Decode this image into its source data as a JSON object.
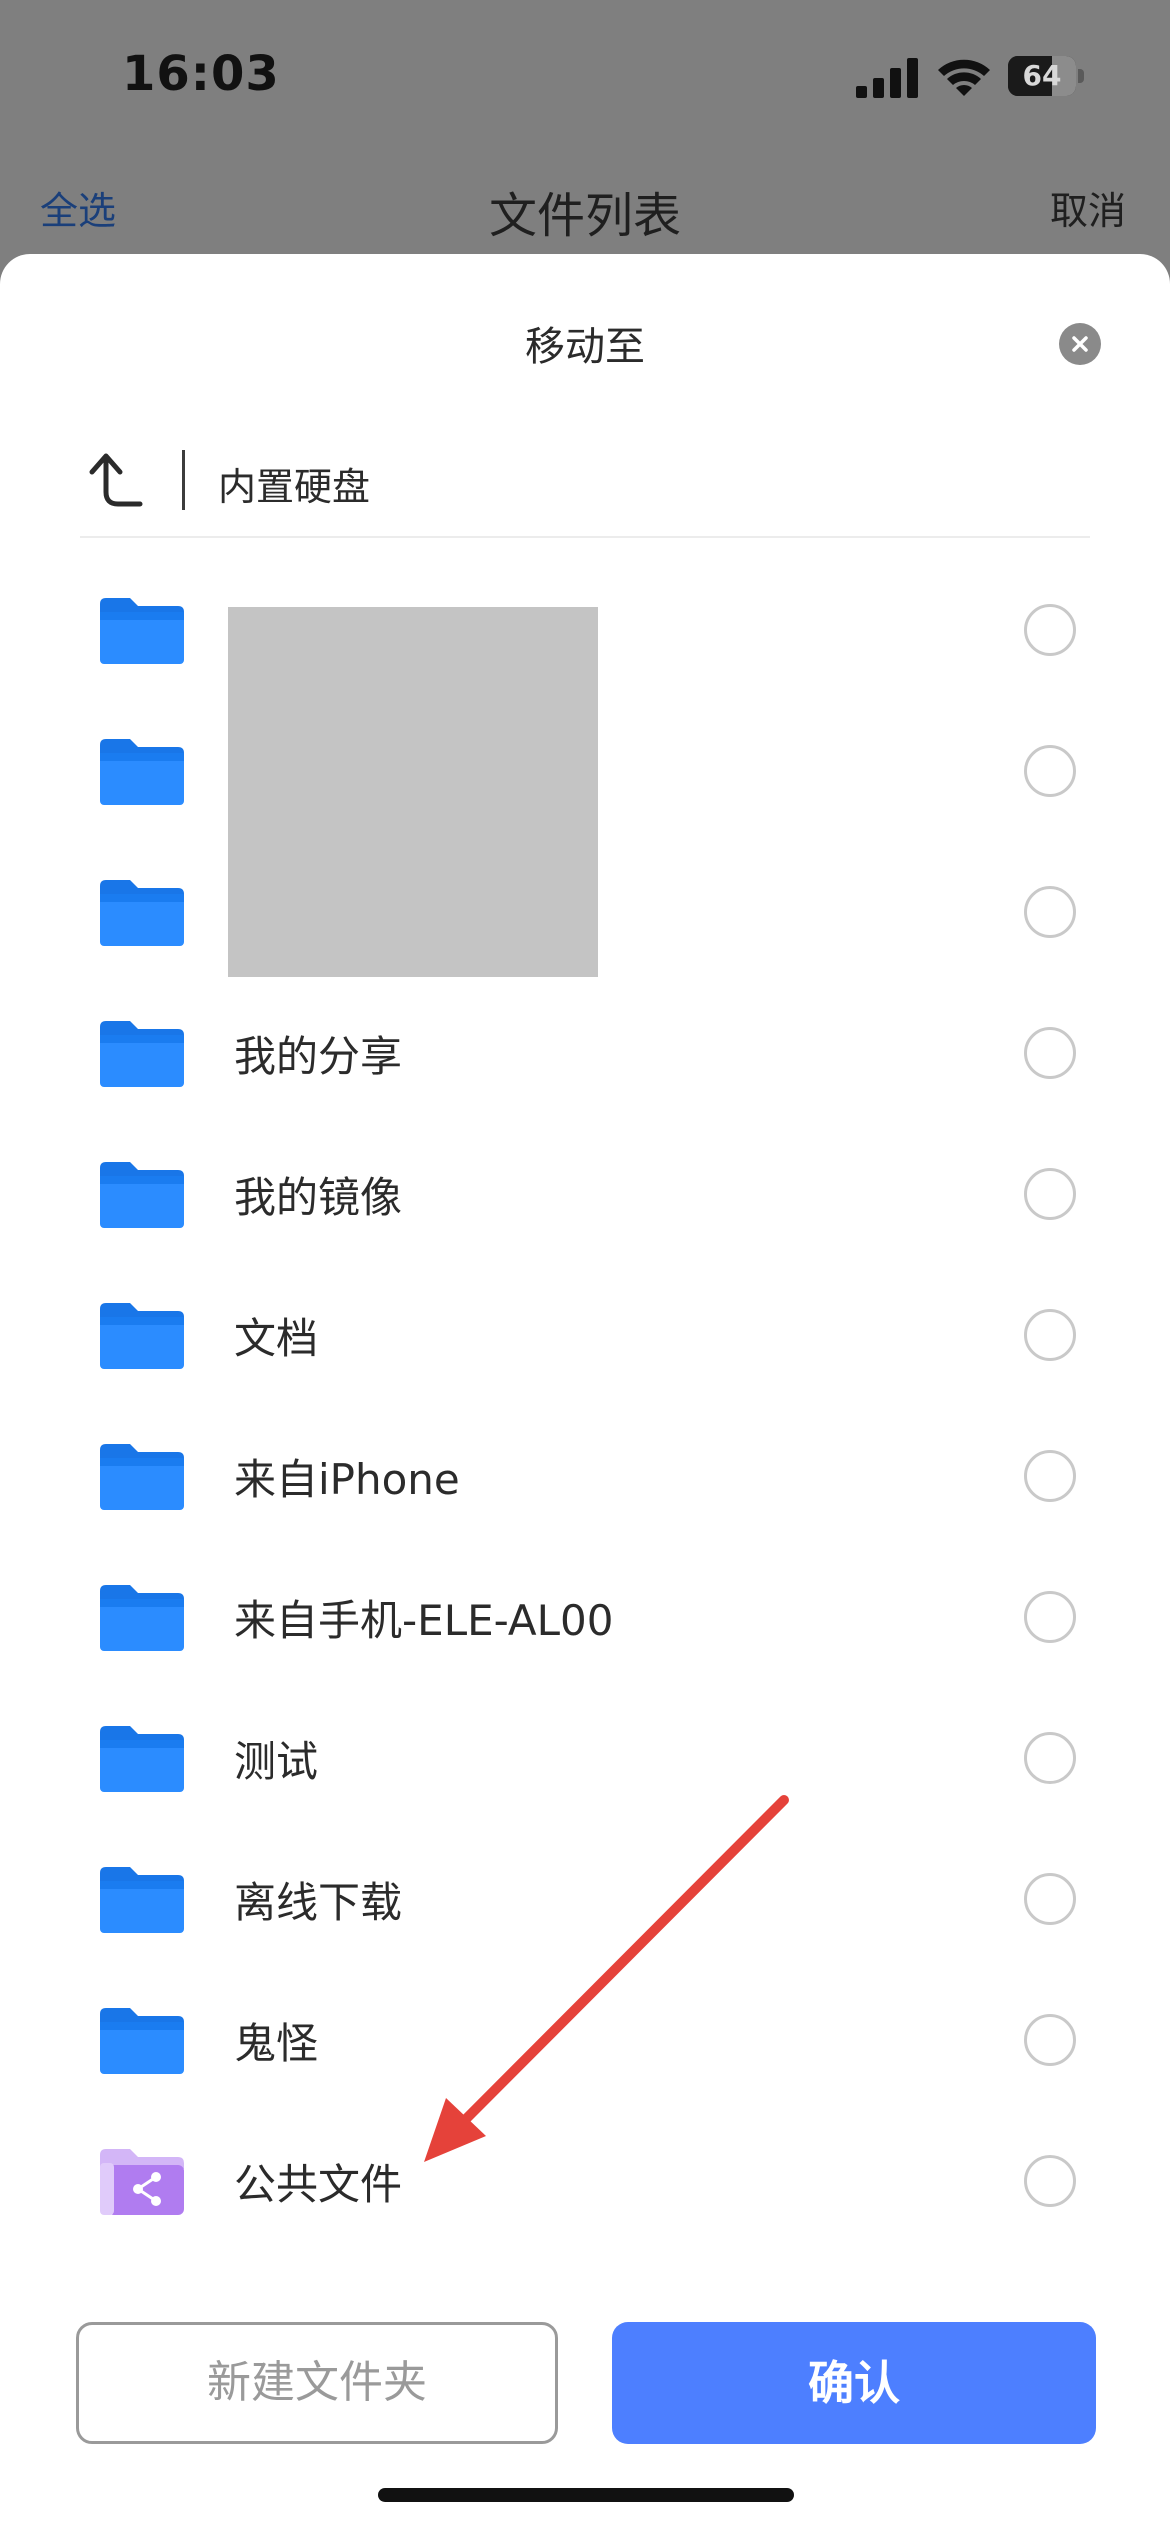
{
  "status_bar": {
    "time": "16:03",
    "battery_level": "64",
    "battery_fraction": 0.64
  },
  "top_nav": {
    "select_all": "全选",
    "title": "文件列表",
    "cancel": "取消"
  },
  "sheet": {
    "title": "移动至",
    "path": "内置硬盘",
    "folders": [
      {
        "name": "",
        "type": "folder",
        "redacted": true
      },
      {
        "name": "",
        "type": "folder",
        "redacted": true
      },
      {
        "name": "",
        "type": "folder",
        "redacted": true
      },
      {
        "name": "我的分享",
        "type": "folder"
      },
      {
        "name": "我的镜像",
        "type": "folder"
      },
      {
        "name": "文档",
        "type": "folder"
      },
      {
        "name": "来自iPhone",
        "type": "folder"
      },
      {
        "name": "来自手机-ELE-AL00",
        "type": "folder"
      },
      {
        "name": "测试",
        "type": "folder"
      },
      {
        "name": "离线下载",
        "type": "folder"
      },
      {
        "name": "鬼怪",
        "type": "folder"
      },
      {
        "name": "公共文件",
        "type": "shared-folder"
      }
    ],
    "new_folder_label": "新建文件夹",
    "confirm_label": "确认"
  },
  "colors": {
    "accent": "#4d7fff",
    "folder_blue": "#1e88ff",
    "shared_folder_purple": "#b07cf0",
    "annotation_red": "#e5423a"
  }
}
